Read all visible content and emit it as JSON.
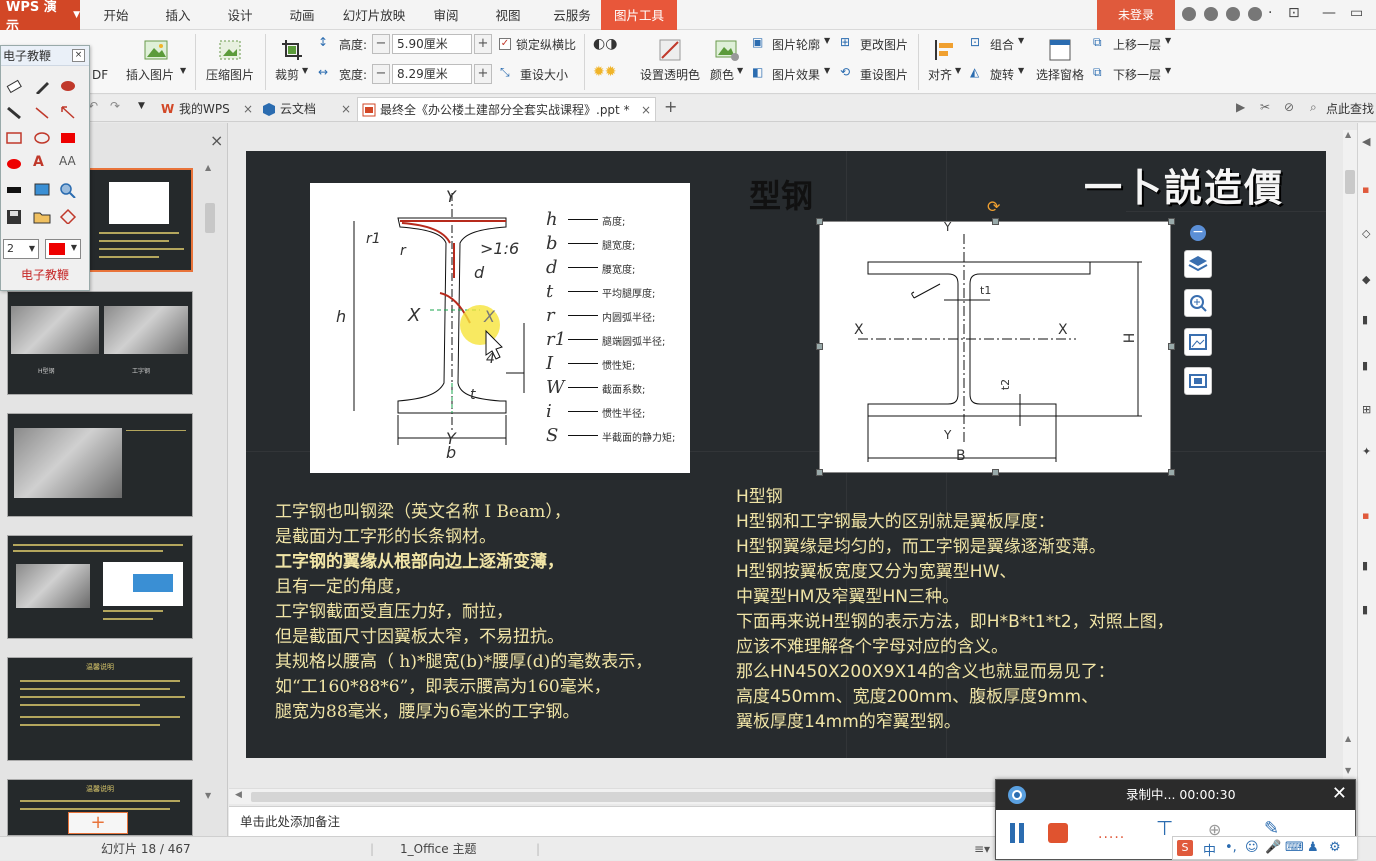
{
  "app": {
    "name": "WPS 演示",
    "login": "未登录"
  },
  "menu": {
    "tabs": [
      "开始",
      "插入",
      "设计",
      "动画",
      "幻灯片放映",
      "审阅",
      "视图",
      "云服务",
      "图片工具"
    ],
    "active": "图片工具"
  },
  "ribbon": {
    "insert_picture": "插入图片",
    "compress_picture": "压缩图片",
    "crop": "裁剪",
    "height_label": "高度:",
    "height_value": "5.90厘米",
    "width_label": "宽度:",
    "width_value": "8.29厘米",
    "lock_ratio": "锁定纵横比",
    "reset_size": "重设大小",
    "set_transparent": "设置透明色",
    "color": "颜色",
    "picture_outline": "图片轮廓",
    "picture_effect": "图片效果",
    "change_picture": "更改图片",
    "reset_picture": "重设图片",
    "align": "对齐",
    "group": "组合",
    "rotate": "旋转",
    "selection_pane": "选择窗格",
    "bring_forward": "上移一层",
    "send_backward": "下移一层",
    "df_fragment": "DF"
  },
  "tabs": [
    {
      "label": "我的WPS"
    },
    {
      "label": "云文档"
    },
    {
      "label": "最终全《办公楼土建部分全套实战课程》.ppt *"
    }
  ],
  "tabbar_search": "点此查找",
  "drawtool": {
    "title": "电子教鞭",
    "footer": "电子教鞭",
    "size": "2"
  },
  "slide": {
    "brand": "一卜説造價",
    "title": "型钢",
    "left_lines": [
      "工字钢也叫钢梁（英文名称 I Beam），",
      "是截面为工字形的长条钢材。",
      "工字钢的翼缘从根部向边上逐渐变薄，",
      "且有一定的角度，",
      "工字钢截面受直压力好，耐拉，",
      "但是截面尺寸因翼板太窄，不易扭抗。",
      "其规格以腰高（ h)*腿宽(b)*腰厚(d)的毫数表示，",
      "如“工160*88*6”，即表示腰高为160毫米，",
      "腿宽为88毫米，腰厚为6毫米的工字钢。"
    ],
    "right_lines": [
      "H型钢",
      "H型钢和工字钢最大的区别就是翼板厚度：",
      "H型钢翼缘是均匀的，而工字钢是翼缘逐渐变薄。",
      "H型钢按翼板宽度又分为宽翼型HW、",
      "中翼型HM及窄翼型HN三种。",
      "下面再来说H型钢的表示方法，即H*B*t1*t2，对照上图，",
      "应该不难理解各个字母对应的含义。",
      "那么HN450X200X9X14的含义也就显而易见了：",
      "高度450mm、宽度200mm、腹板厚度9mm、",
      "翼板厚度14mm的窄翼型钢。"
    ],
    "diagram1": {
      "labels": {
        "Y": "Y",
        "X": "X",
        "h": "h",
        "b": "b",
        "d": "d",
        "t": "t",
        "r": "r",
        "r1": "r1",
        "slope": ">1:6",
        "quarter": "4"
      },
      "legend": [
        {
          "sym": "h",
          "desc": "高度;"
        },
        {
          "sym": "b",
          "desc": "腿宽度;"
        },
        {
          "sym": "d",
          "desc": "腰宽度;"
        },
        {
          "sym": "t",
          "desc": "平均腿厚度;"
        },
        {
          "sym": "r",
          "desc": "内圆弧半径;"
        },
        {
          "sym": "r1",
          "desc": "腿端圆弧半径;"
        },
        {
          "sym": "I",
          "desc": "惯性矩;"
        },
        {
          "sym": "W",
          "desc": "截面系数;"
        },
        {
          "sym": "i",
          "desc": "惯性半径;"
        },
        {
          "sym": "S",
          "desc": "半截面的静力矩;"
        }
      ]
    },
    "diagram2": {
      "labels": {
        "Y": "Y",
        "X": "X",
        "H": "H",
        "B": "B",
        "t1": "t1",
        "t2": "t2"
      }
    }
  },
  "notes_placeholder": "单击此处添加备注",
  "status": {
    "slide": "幻灯片 18 / 467",
    "theme": "1_Office 主题"
  },
  "recorder": {
    "status": "录制中... 00:00:30"
  },
  "thumbs": {
    "t2_labels": [
      "H型钢",
      "工字钢"
    ],
    "t5_title": "温馨说明",
    "t6_title": "温馨说明"
  },
  "colors": {
    "accent": "#e8573a",
    "slide_bg": "#272b2e",
    "slide_text": "#f0e4a6"
  }
}
